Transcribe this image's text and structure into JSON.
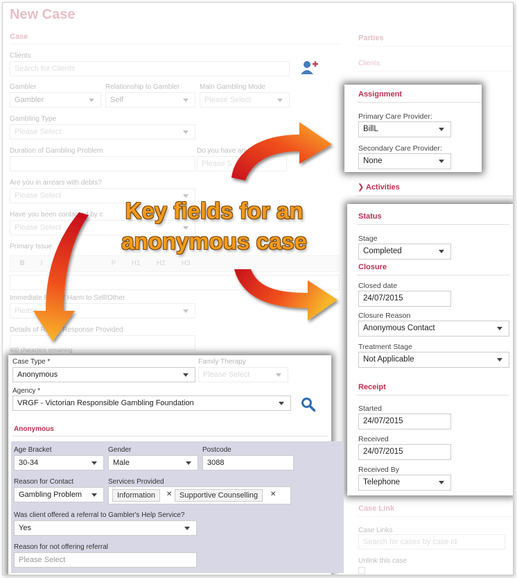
{
  "page": {
    "title": "New Case"
  },
  "case": {
    "heading": "Case",
    "clients_label": "Clients",
    "clients_placeholder": "Search for Clients",
    "gambler_label": "Gambler",
    "gambler_value": "Gambler",
    "relationship_label": "Relationship to Gambler",
    "relationship_value": "Self",
    "mode_label": "Main Gambling Mode",
    "mode_value": "Please Select",
    "type_label": "Gambling Type",
    "type_value": "Please Select",
    "duration_label": "Duration of Gambling Problem",
    "duration_value": "",
    "haveyou_label": "Do you have any",
    "haveyou_value": "Please S",
    "arrears_label": "Are you in arrears with debts?",
    "arrears_value": "Please Select",
    "contacted_label": "Have you been contacted by c",
    "contacted_value": "Please Select",
    "primary_issue_label": "Primary Issue",
    "rte_buttons": [
      "B",
      "I",
      "P",
      "H1",
      "H2",
      "H3"
    ],
    "harm_label": "Immediate Risk of Harm to Self/Other",
    "harm_value": "Please",
    "details_label": "Details of Risk & Response Provided",
    "chars_remaining": "400 characters remaining",
    "case_type_label": "Case Type *",
    "case_type_value": "Anonymous",
    "family_label": "Family Therapy",
    "family_value": "Please Select",
    "agency_label": "Agency *",
    "agency_value": "VRGF - Victorian Responsible Gambling Foundation"
  },
  "anonymous": {
    "heading": "Anonymous",
    "age_label": "Age Bracket",
    "age_value": "30-34",
    "gender_label": "Gender",
    "gender_value": "Male",
    "postcode_label": "Postcode",
    "postcode_value": "3088",
    "reason_label": "Reason for Contact",
    "reason_value": "Gambling Problem",
    "services_label": "Services Provided",
    "services": [
      "Information",
      "Supportive Counselling"
    ],
    "referral_q_label": "Was client offered a referral to Gambler's Help Service?",
    "referral_q_value": "Yes",
    "not_offering_label": "Reason for not offering referral",
    "not_offering_value": "Please Select"
  },
  "parties": {
    "heading": "Parties",
    "clients_label": "Clients:"
  },
  "assignment": {
    "heading": "Assignment",
    "primary_label": "Primary Care Provider:",
    "primary_value": "BillL",
    "secondary_label": "Secondary Care Provider:",
    "secondary_value": "None"
  },
  "activities": {
    "heading": "Activities"
  },
  "status": {
    "heading": "Status",
    "stage_label": "Stage",
    "stage_value": "Completed"
  },
  "closure": {
    "heading": "Closure",
    "closed_date_label": "Closed date",
    "closed_date_value": "24/07/2015",
    "reason_label": "Closure Reason",
    "reason_value": "Anonymous Contact",
    "treatment_label": "Treatment Stage",
    "treatment_value": "Not Applicable"
  },
  "receipt": {
    "heading": "Receipt",
    "started_label": "Started",
    "started_value": "24/07/2015",
    "received_label": "Received",
    "received_value": "24/07/2015",
    "received_by_label": "Received By",
    "received_by_value": "Telephone"
  },
  "case_link": {
    "heading": "Case Link",
    "links_label": "Case Links",
    "links_placeholder": "Search for cases by case id",
    "unlink_label": "Unlink this case"
  },
  "callout": {
    "line1": "Key fields for an",
    "line2": "anonymous case"
  },
  "colors": {
    "accent": "#b8304f",
    "callout": "#f49a1c",
    "link": "#2f6fb5"
  }
}
